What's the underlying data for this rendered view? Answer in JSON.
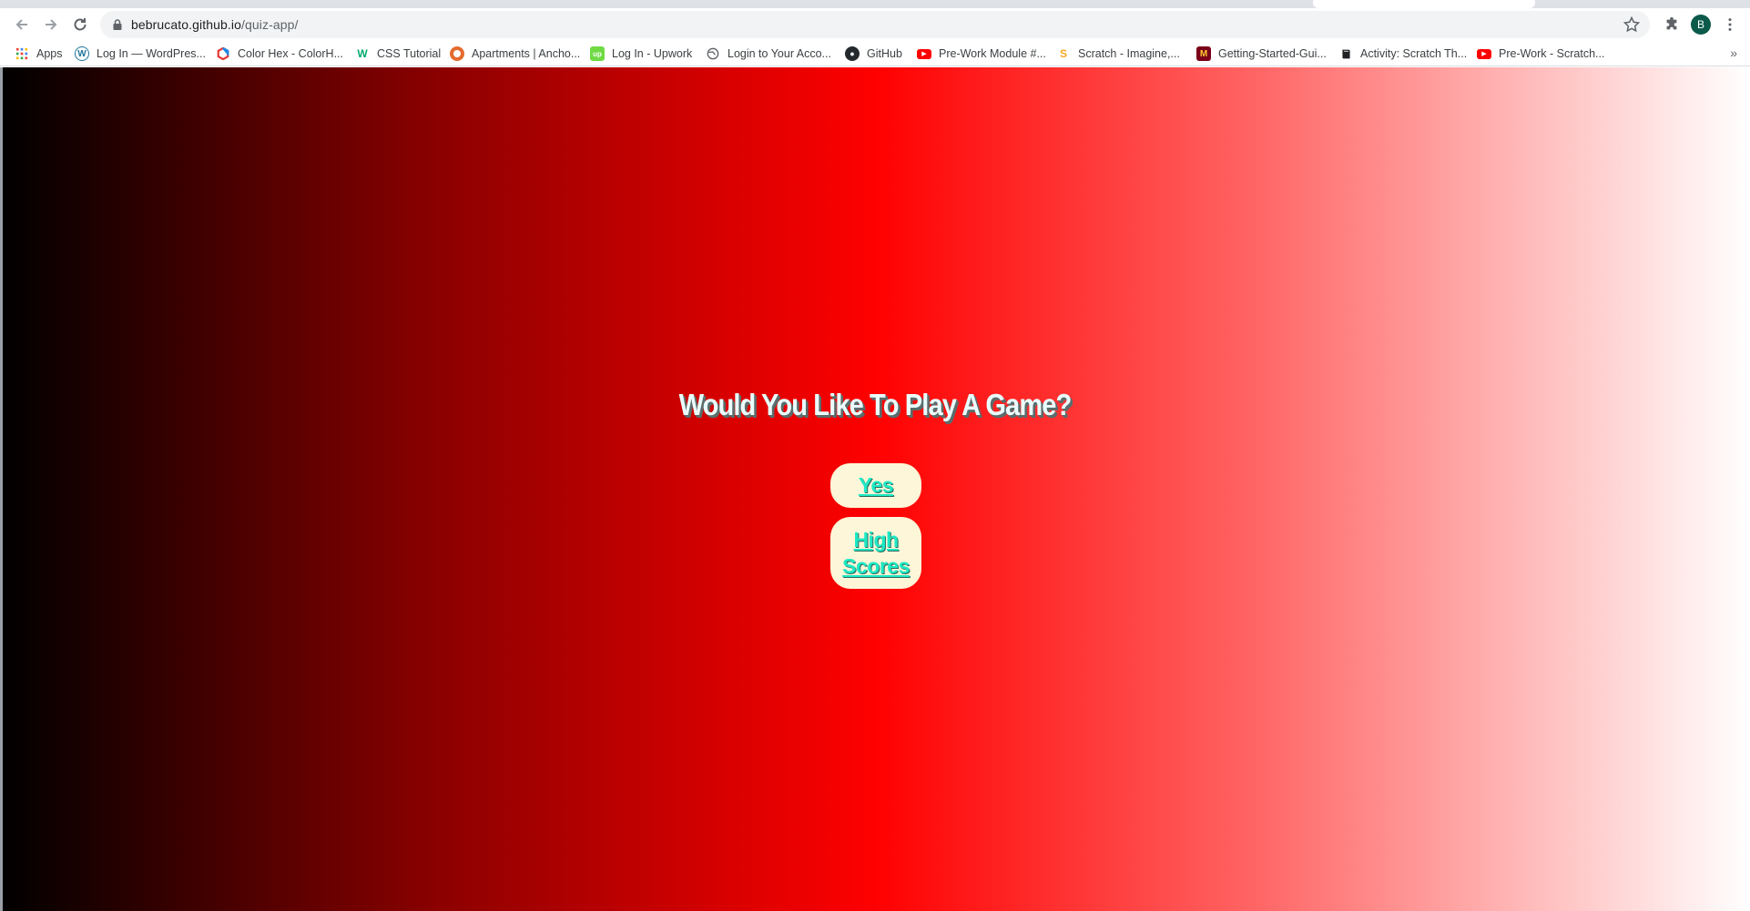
{
  "browser": {
    "url_host": "bebrucato.github.io",
    "url_path": "/quiz-app/",
    "profile_initial": "B",
    "bookmarks": [
      {
        "label": "Apps",
        "icon": "apps-grid-icon"
      },
      {
        "label": "Log In — WordPres...",
        "icon": "wordpress-icon"
      },
      {
        "label": "Color Hex - ColorH...",
        "icon": "colorhex-icon"
      },
      {
        "label": "CSS Tutorial",
        "icon": "w3schools-icon"
      },
      {
        "label": "Apartments | Ancho...",
        "icon": "apartments-icon"
      },
      {
        "label": "Log In - Upwork",
        "icon": "upwork-icon"
      },
      {
        "label": "Login to Your Acco...",
        "icon": "globe-icon"
      },
      {
        "label": "GitHub",
        "icon": "github-icon"
      },
      {
        "label": "Pre-Work Module #...",
        "icon": "youtube-icon"
      },
      {
        "label": "Scratch - Imagine,...",
        "icon": "scratch-icon"
      },
      {
        "label": "Getting-Started-Gui...",
        "icon": "umn-icon"
      },
      {
        "label": "Activity: Scratch Th...",
        "icon": "book-icon"
      },
      {
        "label": "Pre-Work - Scratch...",
        "icon": "youtube-icon"
      }
    ],
    "bookmarks_overflow": "»"
  },
  "page": {
    "title": "Would You Like To Play A Game?",
    "yes_label": "Yes",
    "scores_label_line1": "High",
    "scores_label_line2": "Scores"
  },
  "colors": {
    "gradient": [
      "#000000",
      "#8b0000",
      "#ff0000",
      "#ff6666",
      "#ffffff"
    ],
    "button_bg": "#fdf6d8",
    "button_text": "#1de9c4",
    "title_text": "#eafcfc"
  }
}
